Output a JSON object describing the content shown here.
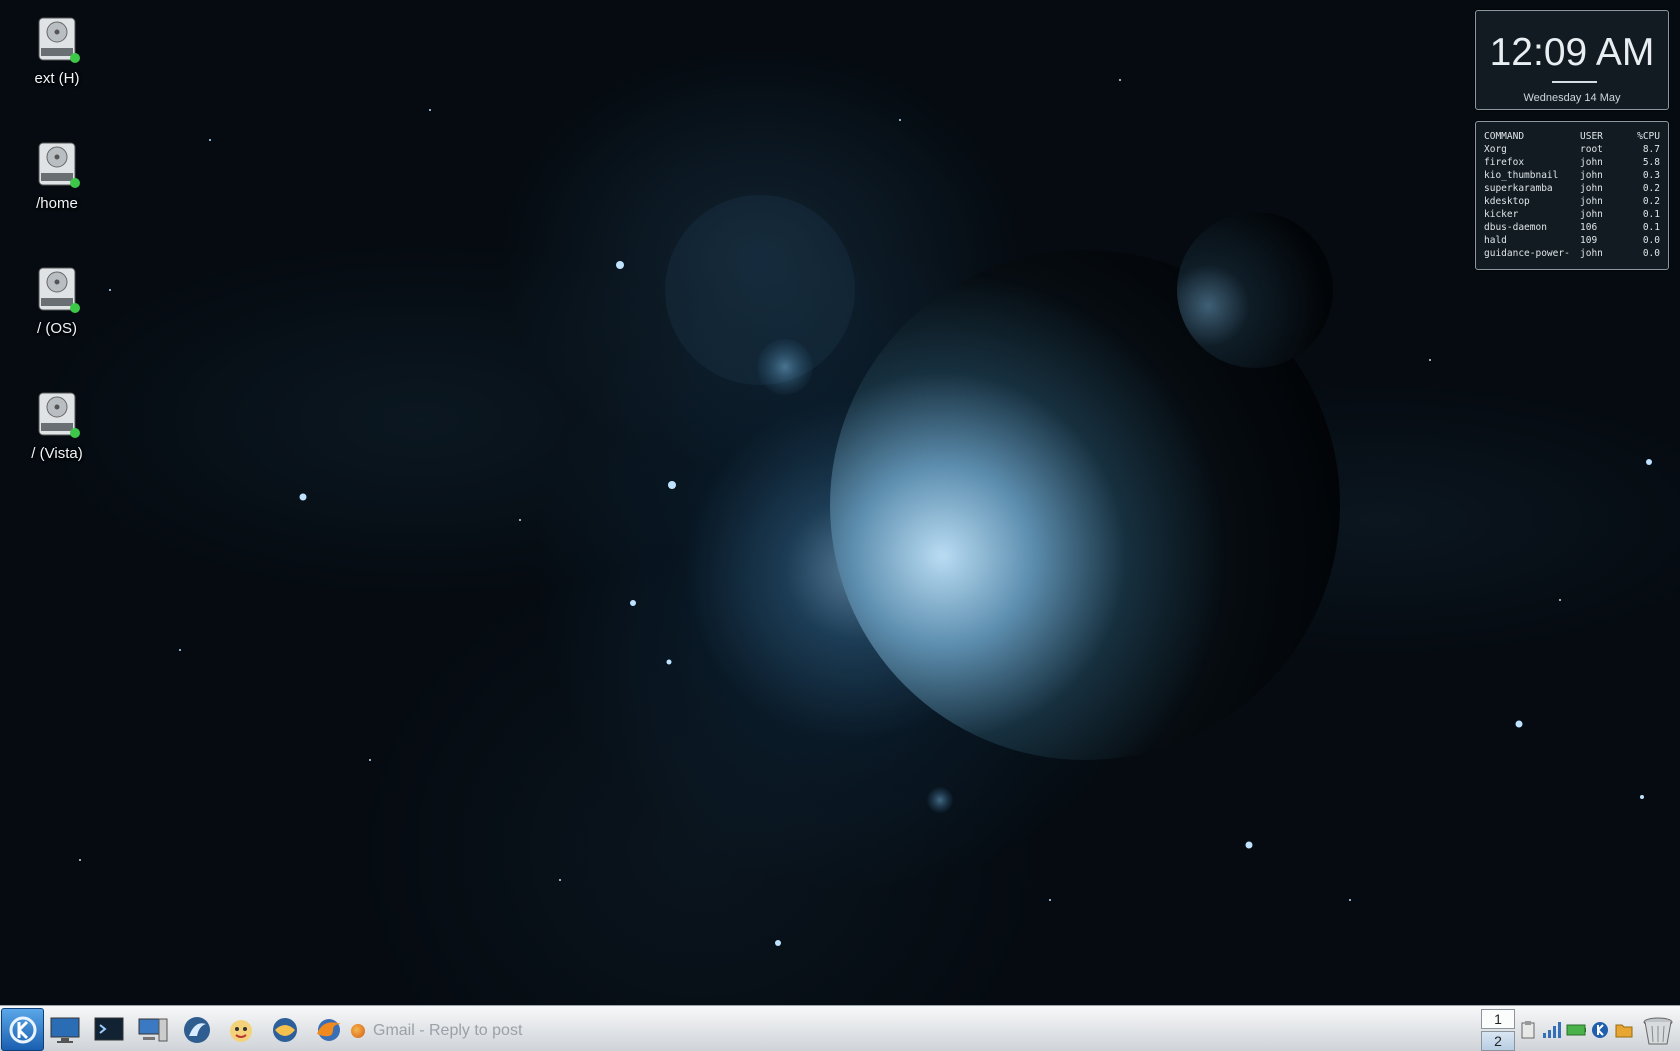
{
  "desktop_icons": [
    {
      "label": "ext (H)",
      "icon": "hard-drive-icon"
    },
    {
      "label": "/home",
      "icon": "hard-drive-icon"
    },
    {
      "label": "/ (OS)",
      "icon": "hard-drive-icon"
    },
    {
      "label": "/ (Vista)",
      "icon": "hard-drive-icon"
    }
  ],
  "clock": {
    "time": "12:09 AM",
    "date": "Wednesday 14 May"
  },
  "process_monitor": {
    "headers": [
      "COMMAND",
      "USER",
      "%CPU"
    ],
    "rows": [
      [
        "Xorg",
        "root",
        "8.7"
      ],
      [
        "firefox",
        "john",
        "5.8"
      ],
      [
        "kio_thumbnail",
        "john",
        "0.3"
      ],
      [
        "superkaramba",
        "john",
        "0.2"
      ],
      [
        "kdesktop",
        "john",
        "0.2"
      ],
      [
        "kicker",
        "john",
        "0.1"
      ],
      [
        "dbus-daemon",
        "106",
        "0.1"
      ],
      [
        "hald",
        "109",
        "0.0"
      ],
      [
        "guidance-power-",
        "john",
        "0.0"
      ]
    ]
  },
  "taskbar": {
    "kmenu_icon": "kde-k-icon",
    "launchers": [
      "desktop-icon",
      "terminal-icon",
      "computer-icon",
      "dolphin-icon",
      "kopete-icon",
      "thunderbird-icon",
      "firefox-icon"
    ],
    "task": "Gmail - Reply to post",
    "pager": [
      "1",
      "2"
    ],
    "tray_icons": [
      "clipboard-icon",
      "network-signal-icon",
      "battery-icon",
      "kde-update-icon",
      "folder-icon"
    ],
    "trash_icon": "trash-icon"
  },
  "colors": {
    "taskbar_bg": "#dfe2e5",
    "widget_border": "#8a98a3",
    "accent_blue": "#1a5fb0"
  }
}
